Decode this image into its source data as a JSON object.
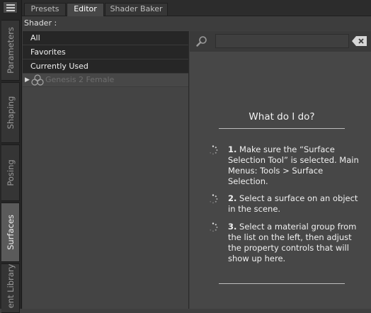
{
  "sidebar": {
    "tabs": [
      {
        "label": "Parameters"
      },
      {
        "label": "Shaping"
      },
      {
        "label": "Posing"
      },
      {
        "label": "Surfaces"
      },
      {
        "label": "ent Library"
      }
    ]
  },
  "tabs": [
    {
      "label": "Presets"
    },
    {
      "label": "Editor"
    },
    {
      "label": "Shader Baker"
    }
  ],
  "shader_label": "Shader :",
  "list": {
    "items": [
      {
        "label": "All"
      },
      {
        "label": "Favorites"
      },
      {
        "label": "Currently Used"
      }
    ],
    "tree_item": "Genesis 2 Female"
  },
  "search": {
    "value": ""
  },
  "help": {
    "title": "What do I do?",
    "steps": [
      {
        "num": "1.",
        "text": "Make sure the “Surface Selection Tool” is selected. Main Menus: Tools > Surface Selection."
      },
      {
        "num": "2.",
        "text": "Select a surface on an object in the scene."
      },
      {
        "num": "3.",
        "text": "Select a material group from the list on the left, then adjust the property controls that will show up here."
      }
    ]
  }
}
